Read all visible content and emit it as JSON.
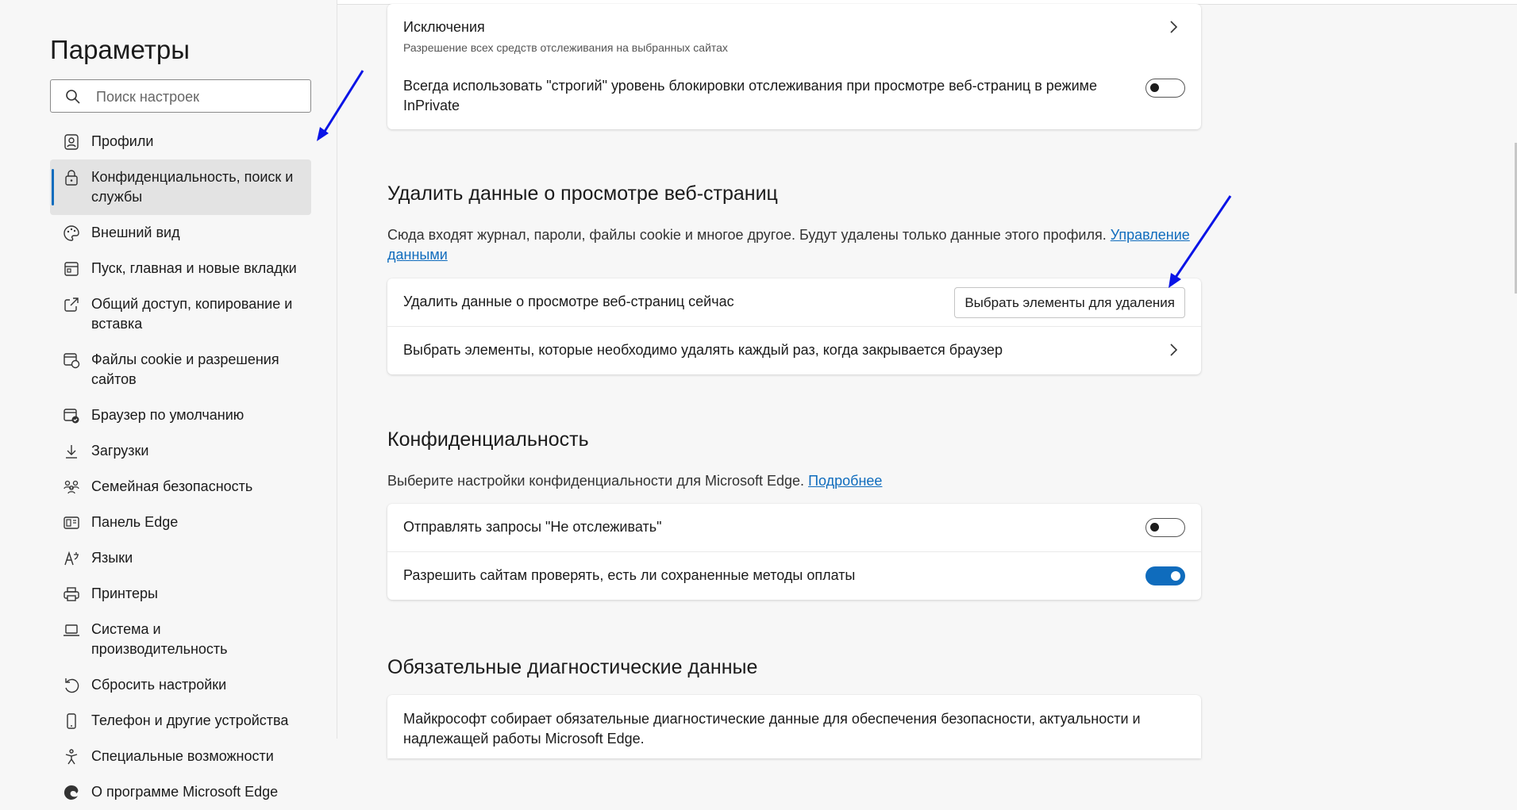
{
  "sidebar": {
    "title": "Параметры",
    "search_placeholder": "Поиск настроек",
    "items": [
      {
        "label": "Профили"
      },
      {
        "label": "Конфиденциальность, поиск и службы"
      },
      {
        "label": "Внешний вид"
      },
      {
        "label": "Пуск, главная и новые вкладки"
      },
      {
        "label": "Общий доступ, копирование и вставка"
      },
      {
        "label": "Файлы cookie и разрешения сайтов"
      },
      {
        "label": "Браузер по умолчанию"
      },
      {
        "label": "Загрузки"
      },
      {
        "label": "Семейная безопасность"
      },
      {
        "label": "Панель Edge"
      },
      {
        "label": "Языки"
      },
      {
        "label": "Принтеры"
      },
      {
        "label": "Система и производительность"
      },
      {
        "label": "Сбросить настройки"
      },
      {
        "label": "Телефон и другие устройства"
      },
      {
        "label": "Специальные возможности"
      },
      {
        "label": "О программе Microsoft Edge"
      }
    ],
    "active_index": 1
  },
  "tracking_card": {
    "exceptions_label": "Исключения",
    "exceptions_sub": "Разрешение всех средств отслеживания на выбранных сайтах",
    "strict_label": "Всегда использовать \"строгий\" уровень блокировки отслеживания при просмотре веб-страниц в режиме InPrivate",
    "strict_on": false
  },
  "clear_data": {
    "title": "Удалить данные о просмотре веб-страниц",
    "desc": "Сюда входят журнал, пароли, файлы cookie и многое другое. Будут удалены только данные этого профиля.",
    "desc_link": "Управление данными",
    "now_label": "Удалить данные о просмотре веб-страниц сейчас",
    "now_button": "Выбрать элементы для удаления",
    "on_close_label": "Выбрать элементы, которые необходимо удалять каждый раз, когда закрывается браузер"
  },
  "privacy": {
    "title": "Конфиденциальность",
    "desc": "Выберите настройки конфиденциальности для Microsoft Edge.",
    "desc_link": "Подробнее",
    "dnt_label": "Отправлять запросы \"Не отслеживать\"",
    "dnt_on": false,
    "payment_label": "Разрешить сайтам проверять, есть ли сохраненные методы оплаты",
    "payment_on": true
  },
  "diagnostics": {
    "title": "Обязательные диагностические данные",
    "text": "Майкрософт собирает обязательные диагностические данные для обеспечения безопасности, актуальности и надлежащей работы Microsoft Edge."
  },
  "colors": {
    "accent": "#0f6cbd",
    "annotation_arrow": "#0a14e6"
  }
}
